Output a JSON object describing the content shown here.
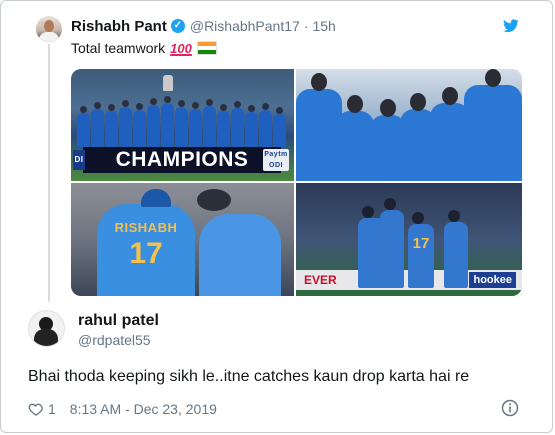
{
  "parent_tweet": {
    "name": "Rishabh Pant",
    "handle": "@RishabhPant17",
    "separator": "·",
    "time": "15h",
    "text": "Total teamwork",
    "emoji_hundred": "100",
    "icons": {
      "verified": "verified-badge-icon",
      "twitter": "twitter-bird-icon",
      "flag": "india-flag-emoji"
    },
    "photos": [
      {
        "alt": "team-celebration-champions",
        "board_text": "CHAMPIONS",
        "sponsor_left": "DI",
        "sponsor_right": "Paytm ODI"
      },
      {
        "alt": "team-huddle-celebration"
      },
      {
        "alt": "players-embrace",
        "jersey_name": "RISHABH",
        "jersey_number": "17"
      },
      {
        "alt": "fielders-celebrate-on-field",
        "board_left": "EVER",
        "board_right": "hookee",
        "jersey_number": "17"
      }
    ]
  },
  "reply": {
    "name": "rahul patel",
    "handle": "@rdpatel55",
    "text": "Bhai thoda keeping sikh le..itne catches kaun drop karta hai re",
    "likes": "1",
    "timestamp": "8:13 AM - Dec 23, 2019"
  },
  "colors": {
    "twitter_blue": "#1da1f2",
    "text_primary": "#14171a",
    "text_secondary": "#657786",
    "border": "#c7ccd1"
  }
}
